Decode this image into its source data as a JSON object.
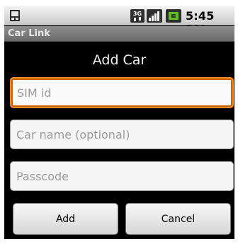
{
  "status_bar": {
    "time": "5:45 PM",
    "network_label": "3G",
    "icons": [
      "notification-icon",
      "3g-icon",
      "signal-icon",
      "battery-icon"
    ]
  },
  "app": {
    "title": "Car Link"
  },
  "dialog": {
    "title": "Add Car",
    "fields": [
      {
        "placeholder": "SIM id",
        "value": ""
      },
      {
        "placeholder": "Car name (optional)",
        "value": ""
      },
      {
        "placeholder": "Passcode",
        "value": ""
      }
    ],
    "buttons": {
      "add": "Add",
      "cancel": "Cancel"
    }
  },
  "colors": {
    "focus": "#f08c1e",
    "background": "#000000"
  }
}
